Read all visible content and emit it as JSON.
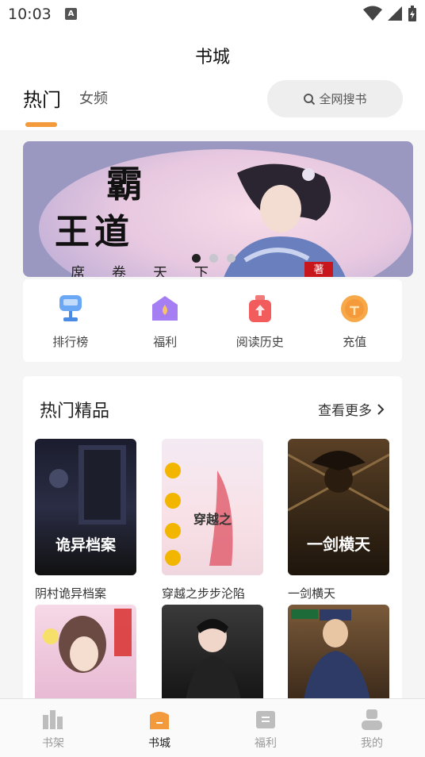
{
  "status_bar": {
    "time": "10:03",
    "notification_glyph": "A"
  },
  "header": {
    "title": "书城",
    "tabs": [
      {
        "label": "热门",
        "active": true
      },
      {
        "label": "女频",
        "active": false
      }
    ],
    "search_label": "全网搜书"
  },
  "banner": {
    "calligraphy_line1": "霸",
    "calligraphy_line2": "王道",
    "bottom_text": "席卷天下",
    "seal_text": "著",
    "page_count": 3,
    "active_page": 1
  },
  "quick_entries": [
    {
      "label": "排行榜",
      "icon": "trophy-icon",
      "color": "#4a90f0"
    },
    {
      "label": "福利",
      "icon": "gift-house-icon",
      "color": "#9b6cf0"
    },
    {
      "label": "阅读历史",
      "icon": "history-bag-icon",
      "color": "#f05a5a"
    },
    {
      "label": "充值",
      "icon": "coin-icon",
      "color": "#f59a3a"
    }
  ],
  "hot_section": {
    "title": "热门精品",
    "more_label": "查看更多",
    "books": [
      {
        "name": "阴村诡异档案",
        "cover_text": "诡异档案"
      },
      {
        "name": "穿越之步步沦陷",
        "cover_text": "穿越之"
      },
      {
        "name": "一剑横天",
        "cover_text": "一剑横天"
      },
      {
        "name": "",
        "cover_text": ""
      },
      {
        "name": "",
        "cover_text": ""
      },
      {
        "name": "",
        "cover_text": ""
      }
    ]
  },
  "bottom_nav": [
    {
      "label": "书架",
      "icon": "bookshelf-icon",
      "active": false
    },
    {
      "label": "书城",
      "icon": "bookstore-icon",
      "active": true
    },
    {
      "label": "福利",
      "icon": "welfare-icon",
      "active": false
    },
    {
      "label": "我的",
      "icon": "profile-icon",
      "active": false
    }
  ],
  "colors": {
    "accent": "#f39a3c",
    "inactive": "#9a9a9a"
  }
}
